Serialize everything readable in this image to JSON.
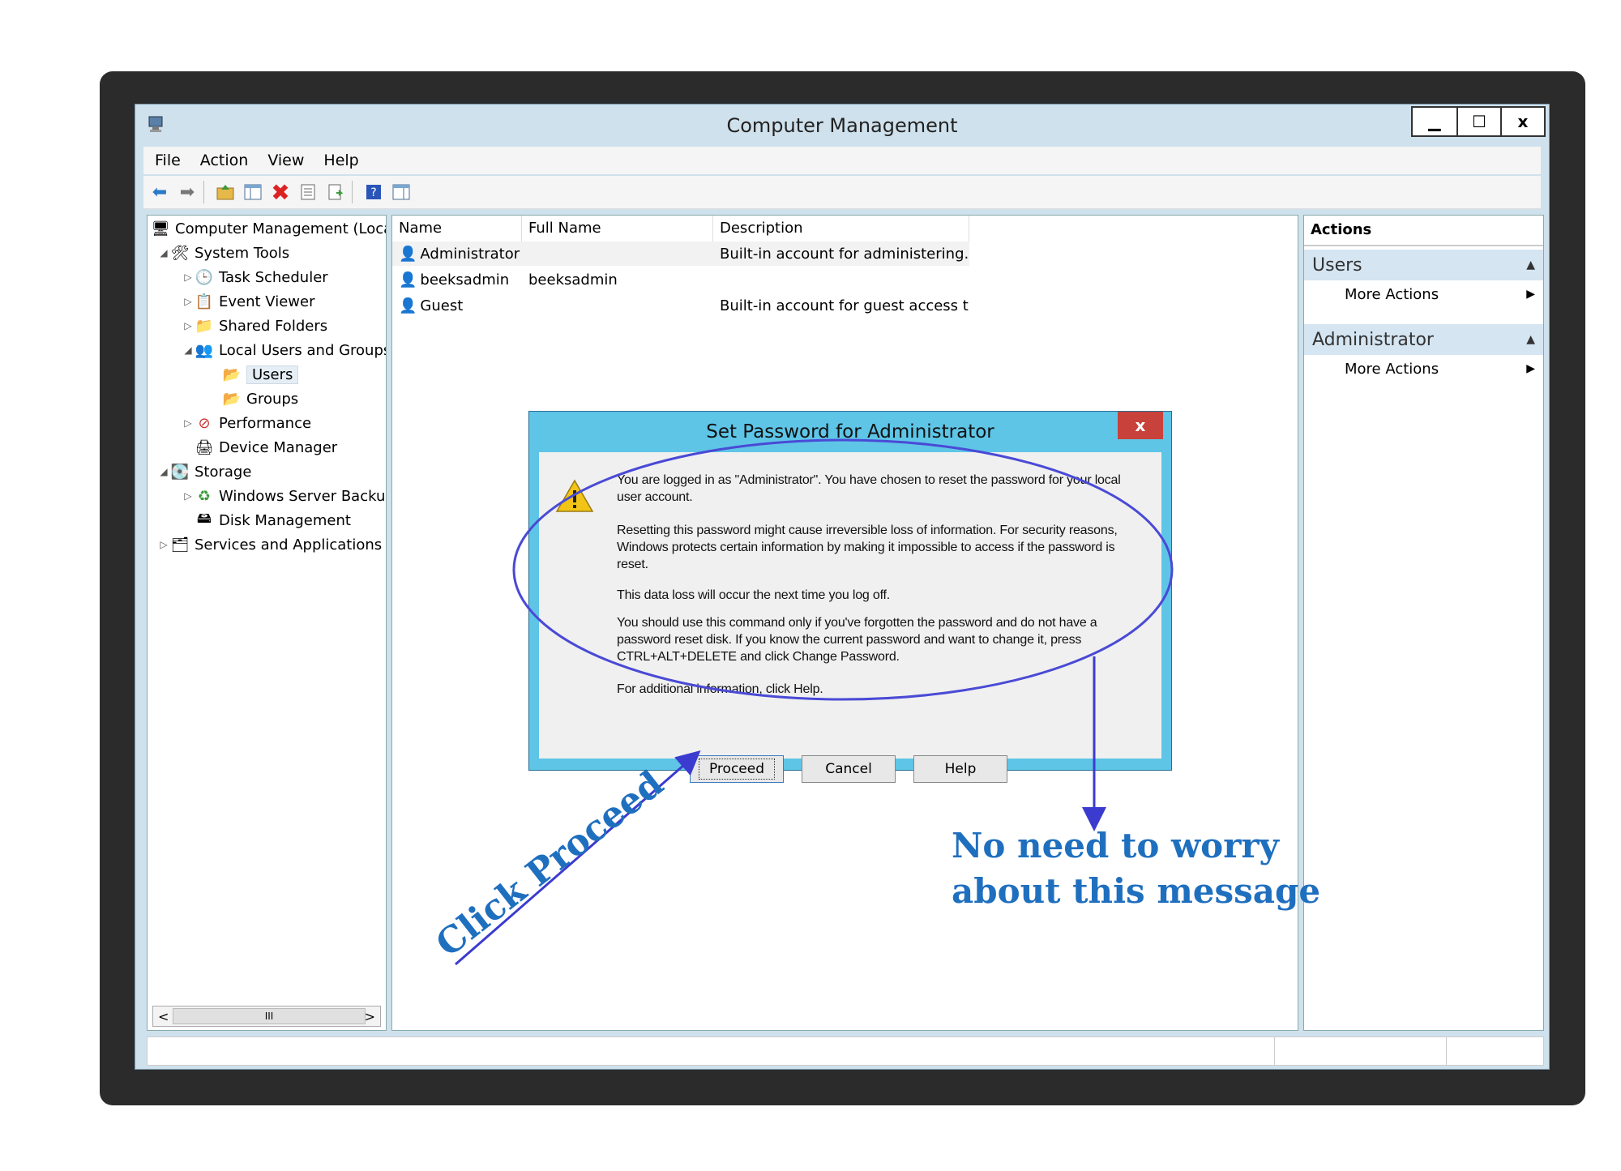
{
  "window": {
    "title": "Computer Management",
    "controls": {
      "minimize": "▁",
      "maximize": "☐",
      "close": "x"
    }
  },
  "menu": [
    "File",
    "Action",
    "View",
    "Help"
  ],
  "tree": {
    "root": "Computer Management (Local",
    "items": [
      {
        "label": "System Tools",
        "indent": 1,
        "twisty": "◢"
      },
      {
        "label": "Task Scheduler",
        "indent": 2,
        "twisty": "▷"
      },
      {
        "label": "Event Viewer",
        "indent": 2,
        "twisty": "▷"
      },
      {
        "label": "Shared Folders",
        "indent": 2,
        "twisty": "▷"
      },
      {
        "label": "Local Users and Groups",
        "indent": 2,
        "twisty": "◢"
      },
      {
        "label": "Users",
        "indent": 3,
        "twisty": ""
      },
      {
        "label": "Groups",
        "indent": 3,
        "twisty": ""
      },
      {
        "label": "Performance",
        "indent": 2,
        "twisty": "▷"
      },
      {
        "label": "Device Manager",
        "indent": 2,
        "twisty": ""
      },
      {
        "label": "Storage",
        "indent": 1,
        "twisty": "◢"
      },
      {
        "label": "Windows Server Backup",
        "indent": 2,
        "twisty": "▷"
      },
      {
        "label": "Disk Management",
        "indent": 2,
        "twisty": ""
      },
      {
        "label": "Services and Applications",
        "indent": 1,
        "twisty": "▷"
      }
    ],
    "scroll": {
      "left": "<",
      "thumb": "III",
      "right": ">"
    }
  },
  "list": {
    "columns": [
      "Name",
      "Full Name",
      "Description"
    ],
    "rows": [
      {
        "name": "Administrator",
        "full_name": "",
        "description": "Built-in account for administering..."
      },
      {
        "name": "beeksadmin",
        "full_name": "beeksadmin",
        "description": ""
      },
      {
        "name": "Guest",
        "full_name": "",
        "description": "Built-in account for guest access t..."
      }
    ]
  },
  "actions": {
    "header": "Actions",
    "sections": [
      {
        "title": "Users",
        "item": "More Actions"
      },
      {
        "title": "Administrator",
        "item": "More Actions"
      }
    ]
  },
  "dialog": {
    "title": "Set Password for Administrator",
    "close": "x",
    "paragraphs": [
      "You are logged in as \"Administrator\". You have chosen to reset the password for your local user account.",
      "Resetting this password might cause irreversible loss of information. For security reasons, Windows protects certain information by making it impossible to access if the password is reset.",
      "This data loss will occur the next time you log off.",
      "You should use this command only if you've forgotten the password and do not have a password reset disk. If you know the current password and want to change it, press CTRL+ALT+DELETE and click Change Password.",
      "For additional information, click Help."
    ],
    "buttons": {
      "proceed": "Proceed",
      "cancel": "Cancel",
      "help": "Help"
    }
  },
  "annotations": {
    "click_proceed": "Click Proceed",
    "no_need_line1": "No need to worry",
    "no_need_line2": "about this message",
    "color": "#1f6fbf"
  }
}
